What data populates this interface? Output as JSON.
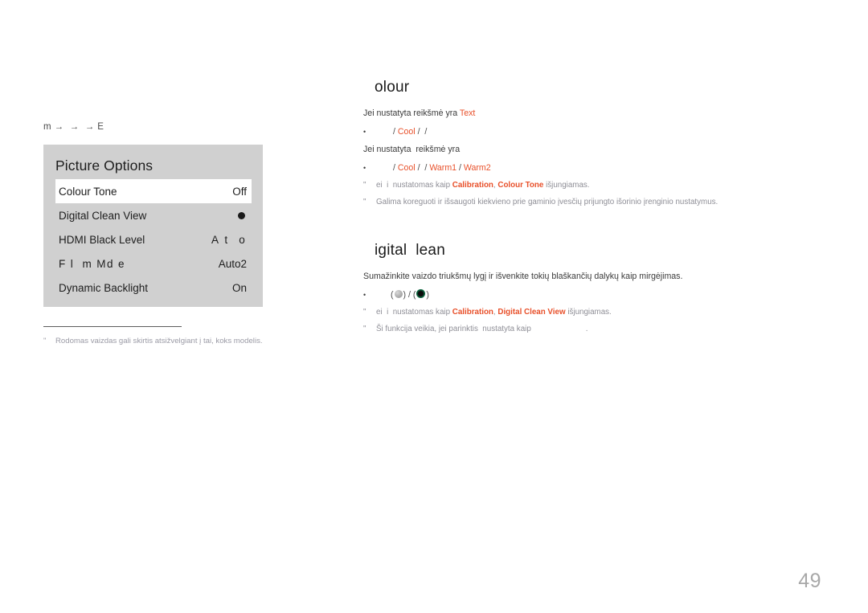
{
  "page": {
    "number": "49",
    "accent_color": "#e8502a",
    "note_color": "#8e8e96"
  },
  "breadcrumb": {
    "text": "m →  →  → E"
  },
  "osd": {
    "title": "Picture Options",
    "rows": [
      {
        "label": "Colour Tone",
        "value": "Off",
        "selected": true
      },
      {
        "label": "Digital Clean View",
        "value": "",
        "selected": false,
        "value_icon": "filled-circle-icon"
      },
      {
        "label": "HDMI Black Level",
        "value": "A t  o",
        "selected": false
      },
      {
        "label": "F l  m Md e",
        "value": "Auto2",
        "selected": false
      },
      {
        "label": "Dynamic Backlight",
        "value": "On",
        "selected": false
      }
    ]
  },
  "left_footnote": {
    "mark": "\"",
    "text": "Rodomas vaizdas gali skirtis atsižvelgiant į tai, koks modelis."
  },
  "sections": [
    {
      "heading": "olour",
      "paragraphs": [
        {
          "pre": "Jei nustatyta ",
          "accent": "",
          "post": "reikšmė yra ",
          "accent_tail": "Text"
        }
      ],
      "bullets": [
        {
          "mark": "•",
          "parts": [
            " / ",
            "Cool",
            " / ",
            " / "
          ]
        }
      ],
      "paragraph2": "Jei nustatyta  reikšmė yra",
      "bullet2": {
        "mark": "•",
        "items": [
          "Cool",
          "Warm1",
          "Warm2"
        ]
      },
      "notes": [
        {
          "mark": "\"",
          "pre": "ei  i  nustatomas kaip ",
          "bold1": "Calibration",
          "mid": ", ",
          "bold2": "Colour Tone",
          "post": " išjungiamas."
        },
        {
          "mark": "\"",
          "text": "Galima koreguoti ir išsaugoti kiekvieno prie gaminio įvesčių prijungto išorinio įrenginio nustatymus."
        }
      ]
    },
    {
      "heading": "igital  lean",
      "intro": "Sumažinkite vaizdo triukšmų lygį ir išvenkite tokių blaškančių dalykų kaip mirgėjimas.",
      "bullet": {
        "mark": "•",
        "left": "(",
        "right": ") / (",
        "end": ")"
      },
      "notes": [
        {
          "mark": "\"",
          "pre": "ei  i  nustatomas kaip ",
          "bold1": "Calibration",
          "mid": ", ",
          "bold2": "Digital Clean View",
          "post": " išjungiamas."
        },
        {
          "mark": "\"",
          "text": "Ši funkcija veikia, jei parinktis  nustatyta kaip                         ."
        }
      ]
    }
  ]
}
